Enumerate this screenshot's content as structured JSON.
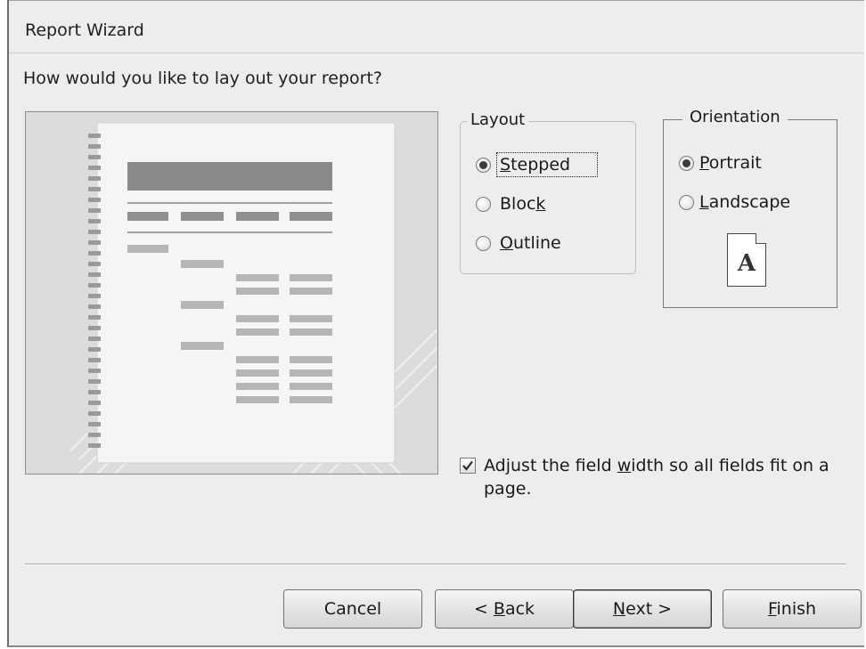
{
  "window": {
    "title": "Report Wizard"
  },
  "prompt": "How would you like to lay out your report?",
  "layout": {
    "legend": "Layout",
    "options": [
      {
        "pre": "",
        "key": "S",
        "post": "tepped",
        "selected": true
      },
      {
        "pre": "Bloc",
        "key": "k",
        "post": "",
        "selected": false
      },
      {
        "pre": "",
        "key": "O",
        "post": "utline",
        "selected": false
      }
    ]
  },
  "orientation": {
    "legend": "Orientation",
    "options": [
      {
        "pre": "",
        "key": "P",
        "post": "ortrait",
        "selected": true
      },
      {
        "pre": "",
        "key": "L",
        "post": "andscape",
        "selected": false
      }
    ],
    "preview_letter": "A"
  },
  "adjust": {
    "checked": true,
    "pre": "Adjust the field ",
    "key": "w",
    "post": "idth so all fields fit on a page."
  },
  "buttons": {
    "cancel": {
      "pre": "Cancel",
      "key": "",
      "post": ""
    },
    "back": {
      "pre": "< ",
      "key": "B",
      "post": "ack"
    },
    "next": {
      "pre": "",
      "key": "N",
      "post": "ext >"
    },
    "finish": {
      "pre": "",
      "key": "F",
      "post": "inish"
    }
  },
  "icons": {
    "preview": "stepped-layout-preview-icon",
    "paper": "portrait-page-icon",
    "check": "check-mark-icon"
  },
  "colors": {
    "dialog_bg": "#ededed",
    "preview_bg": "#dcdcdc",
    "radio_dot": "#3c3c3c"
  }
}
